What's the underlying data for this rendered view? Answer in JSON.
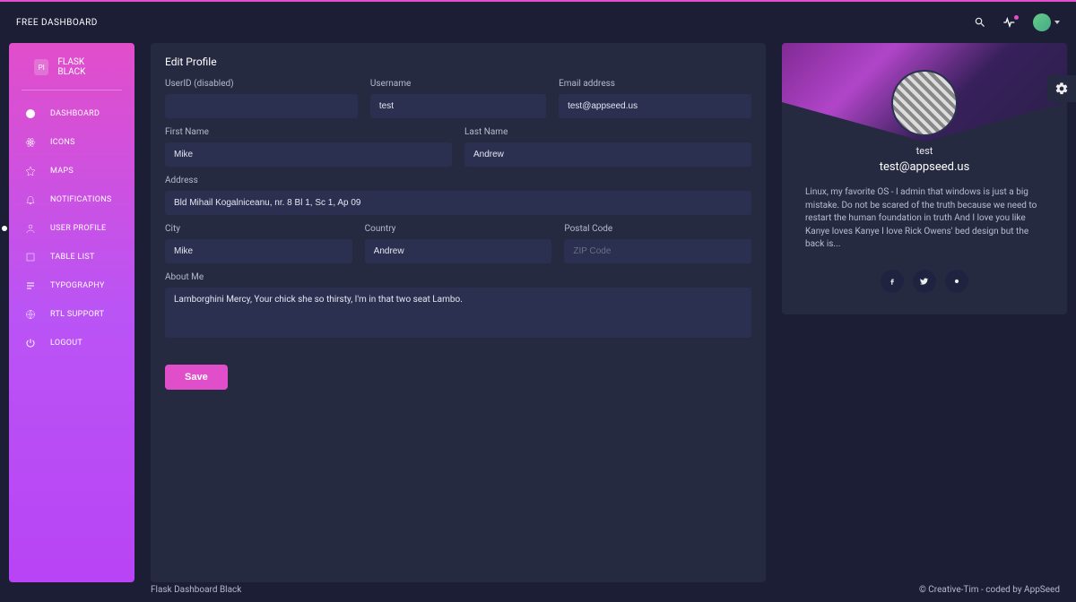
{
  "topbar": {
    "title": "FREE DASHBOARD"
  },
  "sidebar": {
    "logo_text": "PI",
    "brand": "FLASK BLACK",
    "items": [
      {
        "label": "DASHBOARD"
      },
      {
        "label": "ICONS"
      },
      {
        "label": "MAPS"
      },
      {
        "label": "NOTIFICATIONS"
      },
      {
        "label": "USER PROFILE"
      },
      {
        "label": "TABLE LIST"
      },
      {
        "label": "TYPOGRAPHY"
      },
      {
        "label": "RTL SUPPORT"
      },
      {
        "label": "LOGOUT"
      }
    ]
  },
  "form": {
    "title": "Edit Profile",
    "labels": {
      "userid": "UserID (disabled)",
      "username": "Username",
      "email": "Email address",
      "first_name": "First Name",
      "last_name": "Last Name",
      "address": "Address",
      "city": "City",
      "country": "Country",
      "postal": "Postal Code",
      "about": "About Me"
    },
    "values": {
      "userid": "",
      "username": "test",
      "email": "test@appseed.us",
      "first_name": "Mike",
      "last_name": "Andrew",
      "address": "Bld Mihail Kogalniceanu, nr. 8 Bl 1, Sc 1, Ap 09",
      "city": "Mike",
      "country": "Andrew",
      "postal": "",
      "about": "Lamborghini Mercy, Your chick she so thirsty, I'm in that two seat Lambo."
    },
    "placeholders": {
      "postal": "ZIP Code"
    },
    "save": "Save"
  },
  "profile": {
    "name": "test",
    "email": "test@appseed.us",
    "bio": "Linux, my favorite OS - I admin that windows is just a big mistake. Do not be scared of the truth because we need to restart the human foundation in truth And I love you like Kanye loves Kanye I love Rick Owens' bed design but the back is..."
  },
  "footer": {
    "left": "Flask Dashboard Black",
    "right": "© Creative-Tim - coded by AppSeed"
  }
}
